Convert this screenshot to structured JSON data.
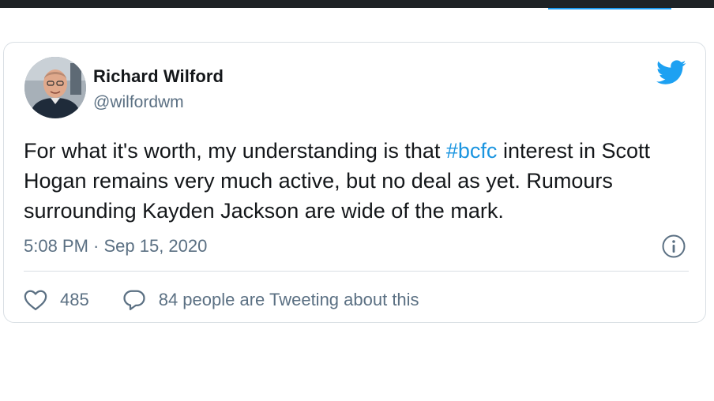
{
  "tweet": {
    "author": {
      "name": "Richard Wilford",
      "handle": "@wilfordwm"
    },
    "text_before": "For what it's worth, my understanding is that ",
    "hashtag": "#bcfc",
    "text_after": " interest in Scott Hogan remains very much active, but no deal as yet. Rumours surrounding Kayden Jackson are wide of the mark.",
    "timestamp": "5:08 PM · Sep 15, 2020",
    "likes": "485",
    "conversation": "84 people are Tweeting about this"
  },
  "icons": {
    "logo": "twitter-bird-icon",
    "info": "info-icon",
    "like": "heart-icon",
    "reply": "speech-bubble-icon"
  },
  "colors": {
    "accent": "#1da1f2",
    "hashtag": "#1b95e0",
    "secondary_text": "#5b7083"
  }
}
